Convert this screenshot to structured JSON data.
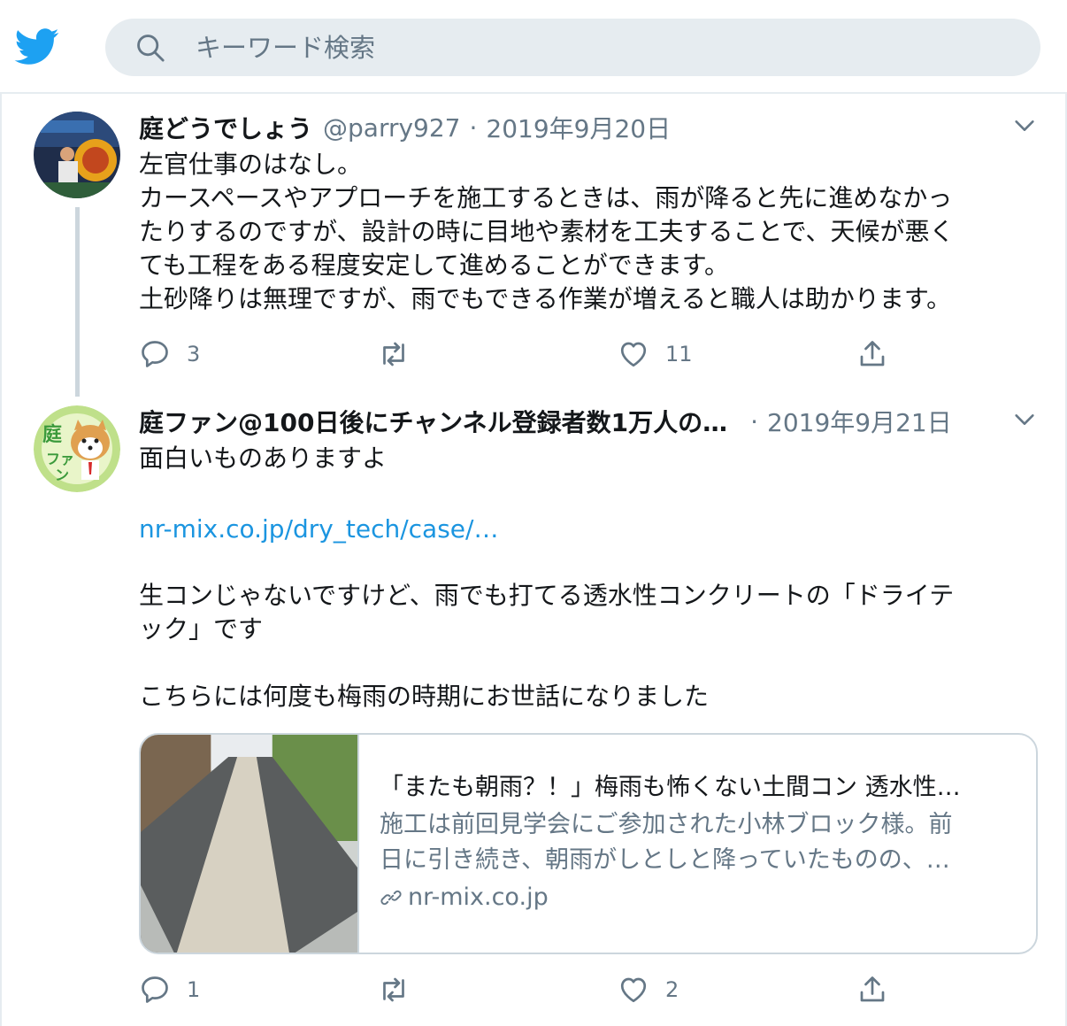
{
  "search": {
    "placeholder": "キーワード検索"
  },
  "tweets": [
    {
      "name": "庭どうでしょう",
      "handle": "@parry927",
      "separator": "·",
      "date": "2019年9月20日",
      "lines": [
        "左官仕事のはなし。",
        "カースペースやアプローチを施工するときは、雨が降ると先に進めなかっ",
        "たりするのですが、設計の時に目地や素材を工夫することで、天候が悪く",
        "ても工程をある程度安定して進めることができます。",
        "土砂降りは無理ですが、雨でもできる作業が増えると職人は助かります。"
      ],
      "reply_count": "3",
      "retweet_count": "",
      "like_count": "11"
    },
    {
      "name": "庭ファン@100日後にチャンネル登録者数1万人の…",
      "separator": "·",
      "date": "2019年9月21日",
      "line1": "面白いものありますよ",
      "link": "nr-mix.co.jp/dry_tech/case/…",
      "line2a": "生コンじゃないですけど、雨でも打てる透水性コンクリートの「ドライテ",
      "line2b": "ック」です",
      "line3": "こちらには何度も梅雨の時期にお世話になりました",
      "card": {
        "title": "「またも朝雨？！」梅雨も怖くない土間コン 透水性…",
        "desc1": "施工は前回見学会にご参加された小林ブロック様。前",
        "desc2": "日に引き続き、朝雨がしとしと降っていたものの、…",
        "domain": "nr-mix.co.jp"
      },
      "reply_count": "1",
      "retweet_count": "",
      "like_count": "2"
    }
  ],
  "icons": {
    "logo": "twitter-bird-icon",
    "search": "search-icon",
    "caret": "chevron-down-icon",
    "reply": "reply-icon",
    "retweet": "retweet-icon",
    "like": "heart-icon",
    "share": "share-icon",
    "link": "link-icon"
  },
  "colors": {
    "brand": "#1da1f2",
    "link": "#1b95e0",
    "secondary_text": "#657786",
    "search_bg": "#e6ecf0"
  }
}
